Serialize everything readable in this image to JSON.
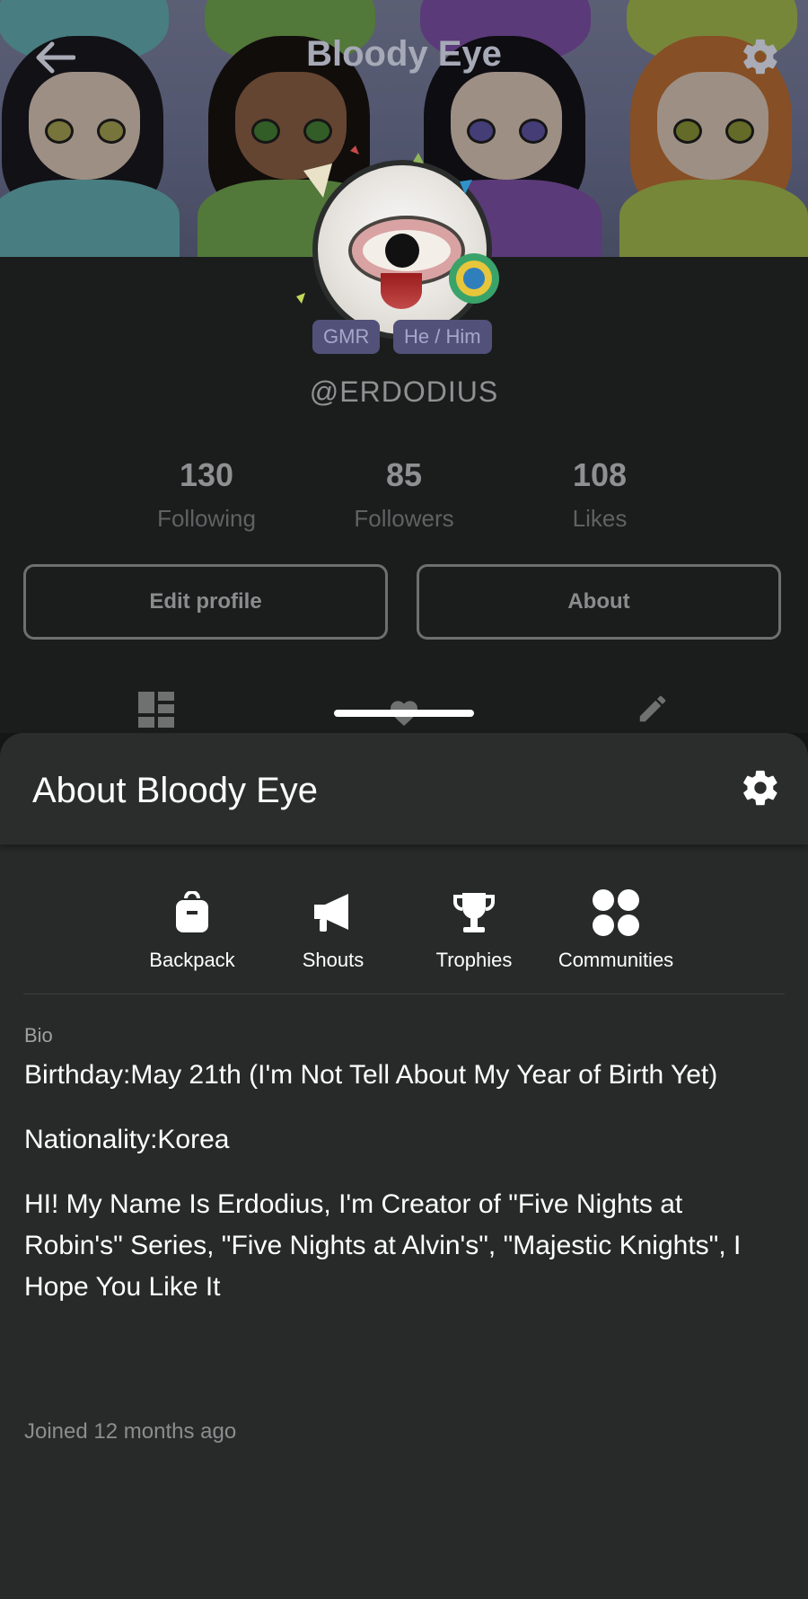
{
  "header": {
    "title": "Bloody Eye",
    "back_icon": "arrow-left-icon",
    "settings_icon": "gear-icon"
  },
  "profile": {
    "tags": [
      "GMR",
      "He / Him"
    ],
    "handle": "@ERDODIUS",
    "stats": [
      {
        "value": "130",
        "label": "Following"
      },
      {
        "value": "85",
        "label": "Followers"
      },
      {
        "value": "108",
        "label": "Likes"
      }
    ],
    "buttons": {
      "edit": "Edit profile",
      "about": "About"
    },
    "tab_icons": [
      "grid-icon",
      "heart-icon",
      "pencil-icon"
    ]
  },
  "about_sheet": {
    "title": "About Bloody Eye",
    "shortcuts": [
      {
        "label": "Backpack",
        "icon": "backpack-icon"
      },
      {
        "label": "Shouts",
        "icon": "megaphone-icon"
      },
      {
        "label": "Trophies",
        "icon": "trophy-icon"
      },
      {
        "label": "Communities",
        "icon": "communities-icon"
      }
    ],
    "bio_label": "Bio",
    "bio": [
      "Birthday:May 21th (I'm Not Tell About My Year of Birth Yet)",
      "Nationality:Korea",
      "HI! My Name Is Erdodius, I'm Creator of \"Five Nights at Robin's\" Series, \"Five Nights at Alvin's\", \"Majestic Knights\", I Hope You Like It"
    ],
    "joined": "Joined 12 months ago"
  },
  "colors": {
    "sheet_bg": "#272a29",
    "page_bg": "#141716",
    "chip_bg": "#52517a",
    "text_white": "#ffffff"
  }
}
